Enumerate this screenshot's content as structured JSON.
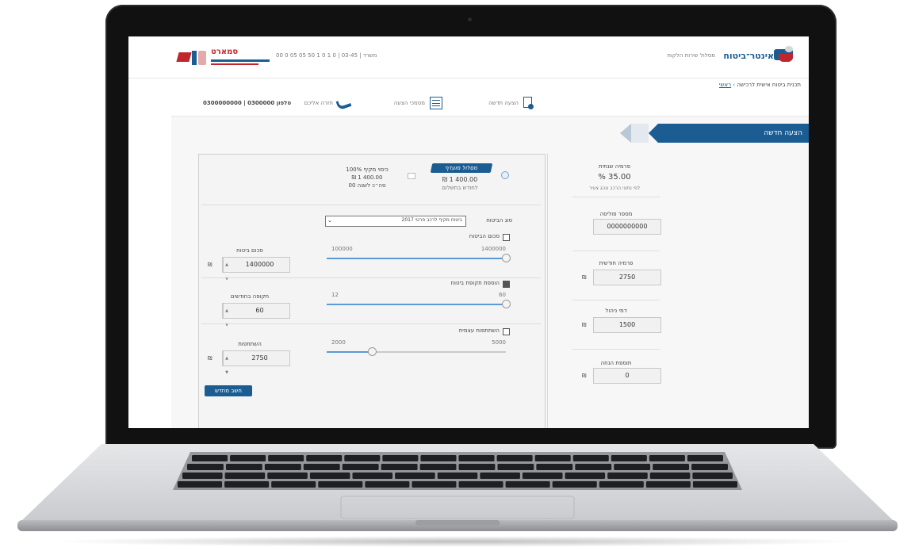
{
  "header": {
    "logo_left_text": "סמארט",
    "logo_right_text": "אינטר־ביטוח",
    "contact_strip": "משרד | 03-45 | 0 1 0 1 50 05 05 0 00",
    "top_nav": "מסלול שירות הלקוח",
    "breadcrumb_home": "ראשי",
    "breadcrumb_sep": "›",
    "breadcrumb_current": "תכנית ביטוח אישית לרכישה"
  },
  "toolbar": {
    "item1": "הצעה חדשה",
    "item2": "מסמכי הצעה",
    "item3": "חזרה אליכם",
    "phone": "0300000000 | 0300000 טלפון"
  },
  "flag_label": "הצעה חדשה",
  "offer": {
    "badge": "מסלול מועדף",
    "price": "₪ 1 400.00",
    "sub": "לחודש בתשלום",
    "alt_line1": "כיסוי מקיף 100%",
    "alt_line2": "₪ 1 400.00",
    "alt_line3": "סה״כ לשנה 00"
  },
  "product_row": {
    "label": "סוג הביטוח",
    "select_value": "ביטוח מקיף לרכב פרטי 2017"
  },
  "slider1": {
    "check_label": "סכום הביטוח",
    "min_label": "100000",
    "max_label": "1400000",
    "field_label": "סכום ביטוח",
    "field_value": "1400000",
    "fill_fraction": 1.0
  },
  "slider2": {
    "check_label": "הוספת תקופת ביטוח",
    "min_label": "12",
    "max_label": "60",
    "field_label": "תקופה בחודשים",
    "field_value": "60",
    "fill_fraction": 1.0
  },
  "slider3": {
    "check_label": "השתתפות עצמית",
    "min_label": "2000",
    "max_label": "5000",
    "field_label": "השתתפות",
    "field_value": "2750",
    "fill_fraction": 0.25
  },
  "calc_button": "חשב מחדש",
  "sidebar": {
    "rate_title": "פרמיה שנתית",
    "rate_value": "% 35.00",
    "rate_sub": "לפי נתוני הרכב ונהג צעיר",
    "f1_label": "מספר פוליסה",
    "f1_value": "0000000000",
    "f2_label": "פרמיה חודשית",
    "f2_value": "2750",
    "f3_label": "דמי ניהול",
    "f3_value": "1500",
    "f4_label": "תוספת הנחה",
    "f4_value": "0",
    "currency": "₪"
  }
}
